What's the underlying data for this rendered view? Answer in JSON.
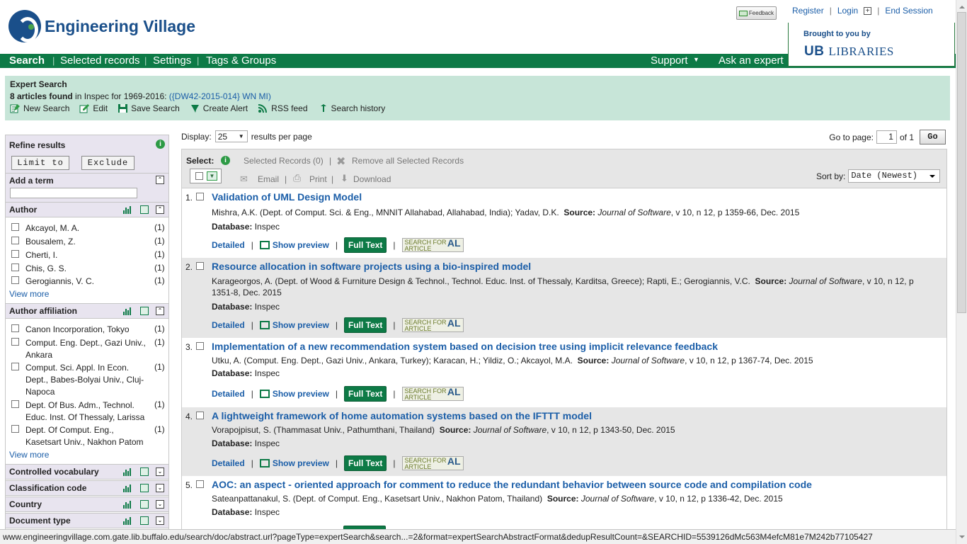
{
  "header": {
    "logo_text": "Engineering Village",
    "feedback_label": "Feedback",
    "register": "Register",
    "login": "Login",
    "end_session": "End Session",
    "brought_by": "Brought to you by",
    "libraries_ub": "UB",
    "libraries_text": "LIBRARIES"
  },
  "nav": {
    "search": "Search",
    "selected_records": "Selected records",
    "settings": "Settings",
    "tags_groups": "Tags & Groups",
    "support": "Support",
    "ask_expert": "Ask an expert"
  },
  "search_summary": {
    "type": "Expert Search",
    "count": "8 articles found",
    "in_text": "in Inspec for 1969-2016:",
    "query": "({DW42-2015-014} WN MI)",
    "tools": [
      "New Search",
      "Edit",
      "Save Search",
      "Create Alert",
      "RSS feed",
      "Search history"
    ]
  },
  "sidebar": {
    "refine_title": "Refine results",
    "limit_to": "Limit to",
    "exclude": "Exclude",
    "add_term": "Add a term",
    "author_title": "Author",
    "authors": [
      {
        "name": "Akcayol, M. A.",
        "count": "(1)"
      },
      {
        "name": "Bousalem, Z.",
        "count": "(1)"
      },
      {
        "name": "Cherti, I.",
        "count": "(1)"
      },
      {
        "name": "Chis, G. S.",
        "count": "(1)"
      },
      {
        "name": "Gerogiannis, V. C.",
        "count": "(1)"
      }
    ],
    "view_more": "View more",
    "affiliation_title": "Author affiliation",
    "affiliations": [
      {
        "name": "Canon Incorporation, Tokyo",
        "count": "(1)"
      },
      {
        "name": "Comput. Eng. Dept., Gazi Univ., Ankara",
        "count": "(1)"
      },
      {
        "name": "Comput. Sci. Appl. In Econ. Dept., Babes-Bolyai Univ., Cluj-Napoca",
        "count": "(1)"
      },
      {
        "name": "Dept. Of Bus. Adm., Technol. Educ. Inst. Of Thessaly, Larissa",
        "count": "(1)"
      },
      {
        "name": "Dept. Of Comput. Eng., Kasetsart Univ., Nakhon Patom",
        "count": "(1)"
      }
    ],
    "collapsed": [
      "Controlled vocabulary",
      "Classification code",
      "Country",
      "Document type"
    ]
  },
  "results_controls": {
    "display_label": "Display:",
    "per_page_value": "25",
    "per_page_text": "results per page",
    "goto_label": "Go to page:",
    "goto_value": "1",
    "of_text": "of 1",
    "go": "Go",
    "select_label": "Select:",
    "selected_records": "Selected Records (0)",
    "remove_all": "Remove all Selected Records",
    "email": "Email",
    "print": "Print",
    "download": "Download",
    "sort_label": "Sort by:",
    "sort_value": "Date (Newest)"
  },
  "record_labels": {
    "source": "Source:",
    "database": "Database:",
    "detailed": "Detailed",
    "show_preview": "Show preview",
    "full_text": "Full Text",
    "sfa_line1": "SEARCH FOR",
    "sfa_line2": "ARTICLE",
    "sfa_mark": "AL"
  },
  "records": [
    {
      "num": "1.",
      "title": "Validation of UML Design Model",
      "authors_html": "Mishra, A.K. (Dept. of Comput. Sci. & Eng., MNNIT Allahabad, Allahabad, India); Yadav, D.K.",
      "journal": "Journal of Software",
      "citation": ", v 10, n 12, p 1359-66, Dec. 2015",
      "database": "Inspec"
    },
    {
      "num": "2.",
      "title": "Resource allocation in software projects using a bio-inspired model",
      "authors_html": "Karageorgos, A. (Dept. of Wood & Furniture Design & Technol., Technol. Educ. Inst. of Thessaly, Karditsa, Greece); Rapti, E.; Gerogiannis, V.C.",
      "journal": "Journal of Software",
      "citation": ", v 10, n 12, p 1351-8, Dec. 2015",
      "database": "Inspec"
    },
    {
      "num": "3.",
      "title": "Implementation of a new recommendation system based on decision tree using implicit relevance feedback",
      "authors_html": "Utku, A. (Comput. Eng. Dept., Gazi Univ., Ankara, Turkey); Karacan, H.; Yildiz, O.; Akcayol, M.A.",
      "journal": "Journal of Software",
      "citation": ", v 10, n 12, p 1367-74, Dec. 2015",
      "database": "Inspec"
    },
    {
      "num": "4.",
      "title": "A lightweight framework of home automation systems based on the IFTTT model",
      "authors_html": "Vorapojpisut, S. (Thammasat Univ., Pathumthani, Thailand)",
      "journal": "Journal of Software",
      "citation": ", v 10, n 12, p 1343-50, Dec. 2015",
      "database": "Inspec"
    },
    {
      "num": "5.",
      "title": "AOC: an aspect - oriented approach for comment to reduce the redundant behavior between source code and compilation code",
      "authors_html": "Sateanpattanakul, S. (Dept. of Comput. Eng., Kasetsart Univ., Nakhon Patom, Thailand)",
      "journal": "Journal of Software",
      "citation": ", v 10, n 12, p 1336-42, Dec. 2015",
      "database": "Inspec"
    }
  ],
  "status_url": "www.engineeringvillage.com.gate.lib.buffalo.edu/search/doc/abstract.url?pageType=expertSearch&search...=2&format=expertSearchAbstractFormat&dedupResultCount=&SEARCHID=5539126dMc563M4efcM81e7M242b77105427",
  "colors": {
    "nav_green": "#0d7a46",
    "link_blue": "#1b5ea8",
    "search_bg": "#c7e5d8",
    "sidebar_head": "#e8e4ef"
  }
}
